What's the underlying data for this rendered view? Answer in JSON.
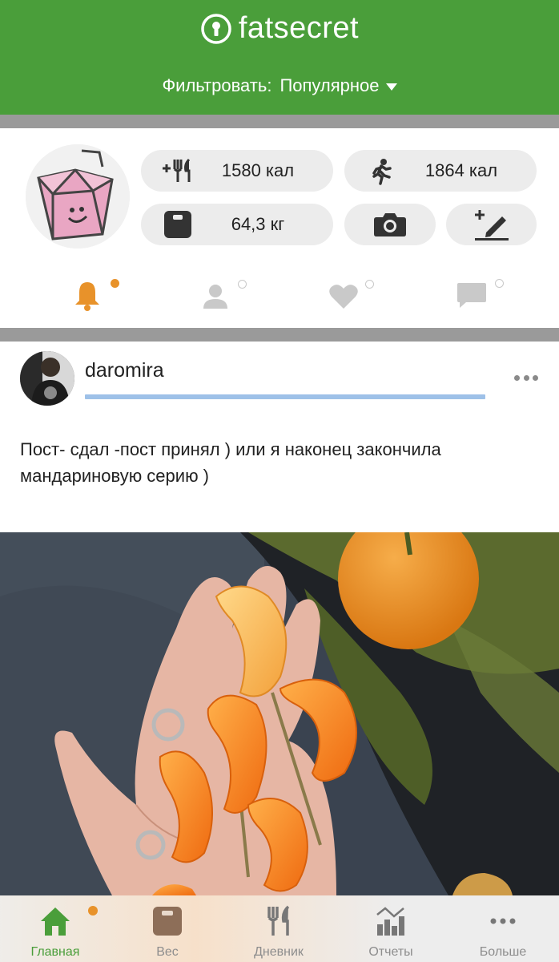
{
  "header": {
    "app_name": "fatsecret",
    "filter_label": "Фильтровать:",
    "filter_value": "Популярное",
    "brand_color": "#4a9e3a"
  },
  "profile": {
    "food_calories": "1580 кал",
    "exercise_calories": "1864 кал",
    "weight": "64,3 кг",
    "icons": {
      "food": "add-food-icon",
      "exercise": "running-icon",
      "weight": "scale-icon",
      "photo": "camera-icon",
      "edit": "add-note-icon"
    }
  },
  "feed_tabs": [
    {
      "icon": "bell-icon",
      "active": true,
      "dot": "filled"
    },
    {
      "icon": "person-icon",
      "active": false,
      "dot": "outline"
    },
    {
      "icon": "heart-icon",
      "active": false,
      "dot": "outline"
    },
    {
      "icon": "comment-icon",
      "active": false,
      "dot": "outline"
    }
  ],
  "post": {
    "username": "daromira",
    "text": "Пост- сдал -пост принял ) или я наконец закончила мандариновую серию )"
  },
  "bottom_nav": [
    {
      "label": "Главная",
      "icon": "home-icon",
      "active": true
    },
    {
      "label": "Вес",
      "icon": "scale-icon",
      "active": false
    },
    {
      "label": "Дневник",
      "icon": "fork-knife-icon",
      "active": false
    },
    {
      "label": "Отчеты",
      "icon": "chart-icon",
      "active": false
    },
    {
      "label": "Больше",
      "icon": "more-icon",
      "active": false
    }
  ],
  "colors": {
    "accent_orange": "#e8922a",
    "tab_inactive": "#c9c9c9",
    "divider": "#9a9a9a",
    "link_underline": "#9ec1e8"
  }
}
